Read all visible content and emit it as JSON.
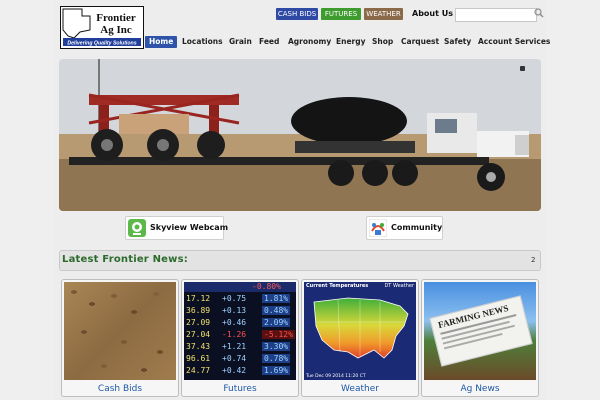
{
  "logo": {
    "line1": "Frontier",
    "line2": "Ag Inc",
    "tagline": "Delivering Quality Solutions"
  },
  "top_buttons": [
    {
      "label": "CASH BIDS",
      "color": "#2f4aa4"
    },
    {
      "label": "FUTURES",
      "color": "#3e9b2e"
    },
    {
      "label": "WEATHER",
      "color": "#8b6a4a"
    }
  ],
  "about_label": "About Us",
  "search": {
    "placeholder": ""
  },
  "nav": [
    "Home",
    "Locations",
    "Grain",
    "Feed",
    "Agronomy",
    "Energy",
    "Shop",
    "Carquest",
    "Safety",
    "Account Services"
  ],
  "quick_links": [
    {
      "label": "Skyview Webcam",
      "icon": "webcam-icon"
    },
    {
      "label": "Community",
      "icon": "community-icon"
    }
  ],
  "news": {
    "title": "Latest Frontier News:",
    "count": "2"
  },
  "tiles": [
    {
      "caption": "Cash Bids",
      "image": "grain-kernels"
    },
    {
      "caption": "Futures",
      "image": "stock-ticker"
    },
    {
      "caption": "Weather",
      "image": "us-temperature-map"
    },
    {
      "caption": "Ag News",
      "image": "farming-news-paper"
    }
  ],
  "ticker": {
    "rows": [
      [
        "17.12",
        "+0.75",
        "1.81%"
      ],
      [
        "36.89",
        "+0.13",
        "0.48%"
      ],
      [
        "27.09",
        "+0.46",
        "2.09%"
      ],
      [
        "27.04",
        "-1.26",
        "-5.12%"
      ],
      [
        "37.43",
        "+1.21",
        "3.30%"
      ],
      [
        "96.61",
        "+0.74",
        "0.78%"
      ],
      [
        "24.77",
        "+0.42",
        "1.69%"
      ]
    ],
    "top_row": "-0.80%"
  },
  "weather_map": {
    "title": "Current Temperatures",
    "brand": "DT Weather",
    "timestamp": "Tue Dec 09 2014 11:20 CT"
  },
  "newspaper_headline": "FARMING NEWS",
  "colors": {
    "nav_active": "#2f53a8",
    "news_title": "#2b6b2b",
    "caption": "#1e58a8"
  }
}
